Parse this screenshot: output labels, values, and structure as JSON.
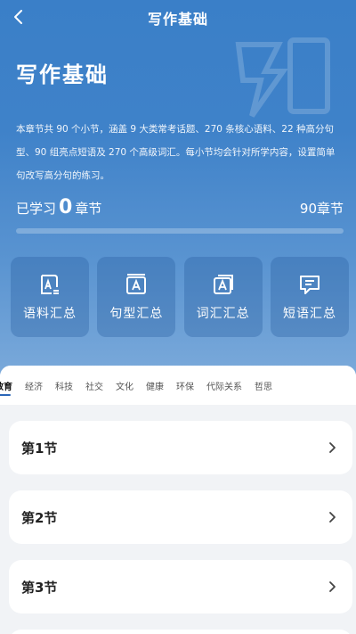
{
  "nav": {
    "title": "写作基础",
    "back_icon": "chevron-left-icon"
  },
  "hero": {
    "title": "写作基础",
    "description": "本章节共 90 个小节，涵盖 9 大类常考话题、270 条核心语料、22 种高分句型、90 组亮点短语及 270 个高级词汇。每小节均会针对所学内容，设置简单句改写高分句的练习。",
    "learned_prefix": "已学习",
    "learned_count": "0",
    "learned_suffix": "章节",
    "total": "90章节",
    "progress_fraction": 0
  },
  "tools": [
    {
      "label": "语料汇总",
      "icon": "corpus-icon"
    },
    {
      "label": "句型汇总",
      "icon": "sentence-pattern-icon"
    },
    {
      "label": "词汇汇总",
      "icon": "vocabulary-icon"
    },
    {
      "label": "短语汇总",
      "icon": "phrase-icon"
    }
  ],
  "tabs": [
    {
      "label": "教育",
      "active": true
    },
    {
      "label": "经济"
    },
    {
      "label": "科技"
    },
    {
      "label": "社交"
    },
    {
      "label": "文化"
    },
    {
      "label": "健康"
    },
    {
      "label": "环保"
    },
    {
      "label": "代际关系"
    },
    {
      "label": "哲思"
    }
  ],
  "sections": [
    {
      "label": "第1节"
    },
    {
      "label": "第2节"
    },
    {
      "label": "第3节"
    }
  ],
  "colors": {
    "accent": "#2a66b8",
    "hero_top": "#3a7fc8",
    "hero_bottom": "#7aa9da"
  }
}
